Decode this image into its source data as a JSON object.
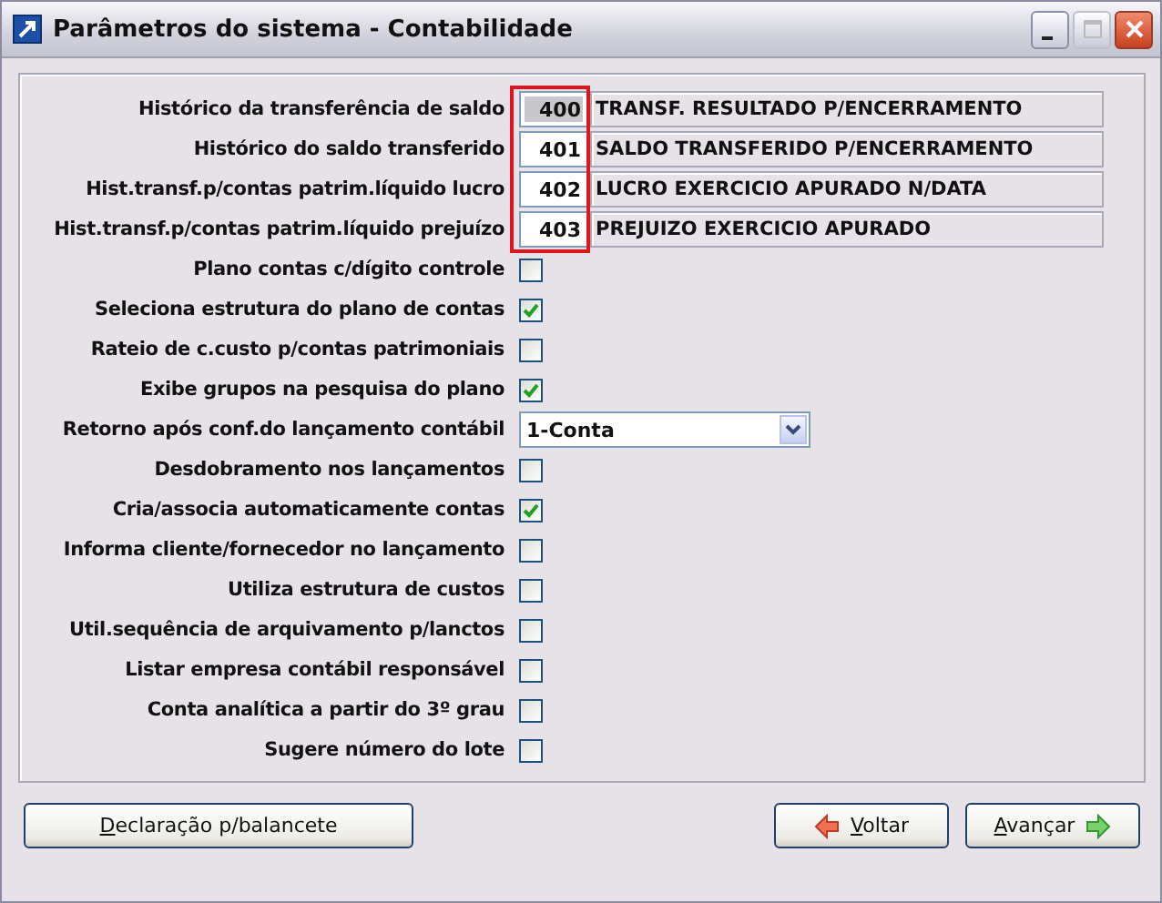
{
  "window": {
    "title": "Parâmetros do sistema - Contabilidade"
  },
  "fields": [
    {
      "kind": "code",
      "label": "Histórico da transferência de saldo",
      "code": "400",
      "description": "TRANSF. RESULTADO P/ENCERRAMENTO",
      "selected": true
    },
    {
      "kind": "code",
      "label": "Histórico do saldo transferido",
      "code": "401",
      "description": "SALDO TRANSFERIDO P/ENCERRAMENTO",
      "selected": false
    },
    {
      "kind": "code",
      "label": "Hist.transf.p/contas patrim.líquido lucro",
      "code": "402",
      "description": "LUCRO EXERCICIO APURADO N/DATA",
      "selected": false
    },
    {
      "kind": "code",
      "label": "Hist.transf.p/contas patrim.líquido prejuízo",
      "code": "403",
      "description": "PREJUIZO EXERCICIO APURADO",
      "selected": false
    },
    {
      "kind": "check",
      "label": "Plano contas c/dígito controle",
      "checked": false
    },
    {
      "kind": "check",
      "label": "Seleciona estrutura do plano de contas",
      "checked": true
    },
    {
      "kind": "check",
      "label": "Rateio de c.custo p/contas patrimoniais",
      "checked": false
    },
    {
      "kind": "check",
      "label": "Exibe grupos na pesquisa do plano",
      "checked": true
    },
    {
      "kind": "select",
      "label": "Retorno após conf.do lançamento contábil",
      "value": "1-Conta"
    },
    {
      "kind": "check",
      "label": "Desdobramento nos lançamentos",
      "checked": false
    },
    {
      "kind": "check",
      "label": "Cria/associa automaticamente contas",
      "checked": true
    },
    {
      "kind": "check",
      "label": "Informa cliente/fornecedor no lançamento",
      "checked": false
    },
    {
      "kind": "check",
      "label": "Utiliza estrutura de custos",
      "checked": false
    },
    {
      "kind": "check",
      "label": "Util.sequência de arquivamento p/lanctos",
      "checked": false
    },
    {
      "kind": "check",
      "label": "Listar empresa contábil responsável",
      "checked": false
    },
    {
      "kind": "check",
      "label": "Conta analítica a partir do 3º grau",
      "checked": false
    },
    {
      "kind": "check",
      "label": "Sugere número do lote",
      "checked": false
    }
  ],
  "buttons": [
    {
      "kind": "plain",
      "accel": "D",
      "rest": "eclaração p/balancete"
    },
    {
      "kind": "back",
      "accel": "V",
      "rest": "oltar"
    },
    {
      "kind": "next",
      "accel": "A",
      "rest": "vançar"
    }
  ]
}
